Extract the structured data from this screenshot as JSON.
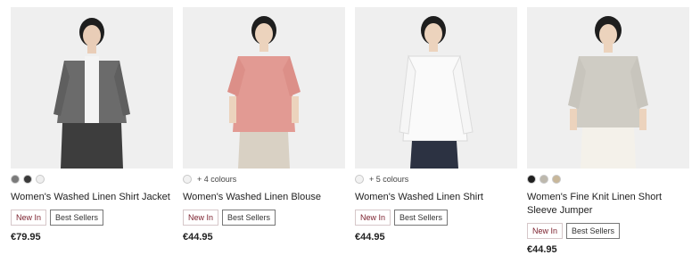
{
  "products": [
    {
      "name": "Women's Washed Linen Shirt Jacket",
      "price": "€79.95",
      "more_colours": "",
      "swatches": [
        "#7a7a7a",
        "#3a3a3a",
        "#efefef"
      ],
      "badges": {
        "new": "New In",
        "best": "Best Sellers"
      }
    },
    {
      "name": "Women's Washed Linen Blouse",
      "price": "€44.95",
      "more_colours": "+ 4 colours",
      "swatches": [
        "#f2f2f2"
      ],
      "badges": {
        "new": "New In",
        "best": "Best Sellers"
      }
    },
    {
      "name": "Women's Washed Linen Shirt",
      "price": "€44.95",
      "more_colours": "+ 5 colours",
      "swatches": [
        "#f2f2f2"
      ],
      "badges": {
        "new": "New In",
        "best": "Best Sellers"
      }
    },
    {
      "name": "Women's Fine Knit Linen Short Sleeve Jumper",
      "price": "€44.95",
      "more_colours": "",
      "swatches": [
        "#1f1f1f",
        "#bdb8ad",
        "#c8b79a"
      ],
      "badges": {
        "new": "New In",
        "best": "Best Sellers"
      }
    }
  ]
}
